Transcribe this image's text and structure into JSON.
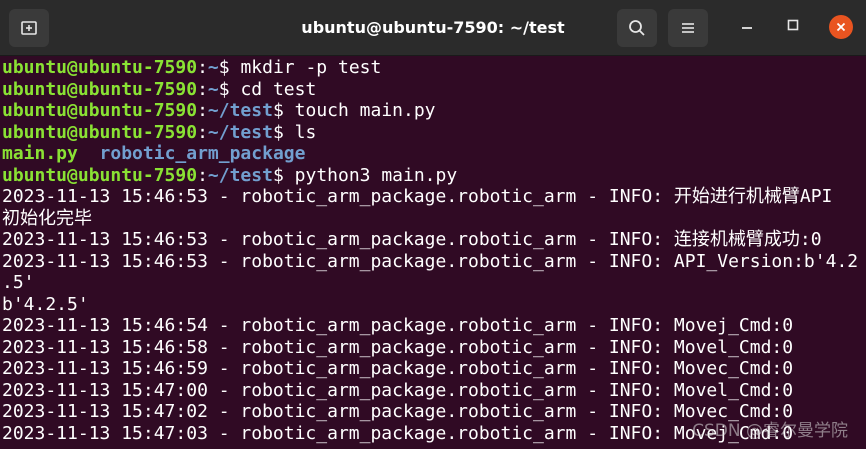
{
  "window": {
    "title": "ubuntu@ubuntu-7590: ~/test",
    "buttons": {
      "new_tab_icon": "new-tab-icon",
      "search_icon": "search-icon",
      "menu_icon": "hamburger-menu-icon",
      "minimize_icon": "minimize-icon",
      "maximize_icon": "maximize-icon",
      "close_icon": "close-icon"
    },
    "colors": {
      "background": "#300a24",
      "prompt_user": "#8ae234",
      "prompt_path": "#729fcf",
      "close_button": "#e95420"
    }
  },
  "terminal": {
    "prompts": [
      {
        "user": "ubuntu@ubuntu-7590",
        "sep": ":",
        "path": "~",
        "sym": "$ ",
        "cmd": "mkdir -p test"
      },
      {
        "user": "ubuntu@ubuntu-7590",
        "sep": ":",
        "path": "~",
        "sym": "$ ",
        "cmd": "cd test"
      },
      {
        "user": "ubuntu@ubuntu-7590",
        "sep": ":",
        "path": "~/test",
        "sym": "$ ",
        "cmd": "touch main.py"
      },
      {
        "user": "ubuntu@ubuntu-7590",
        "sep": ":",
        "path": "~/test",
        "sym": "$ ",
        "cmd": "ls"
      }
    ],
    "ls_output": {
      "file": "main.py",
      "gap": "  ",
      "dir": "robotic_arm_package"
    },
    "prompt5": {
      "user": "ubuntu@ubuntu-7590",
      "sep": ":",
      "path": "~/test",
      "sym": "$ ",
      "cmd": "python3 main.py"
    },
    "output": [
      "2023-11-13 15:46:53 - robotic_arm_package.robotic_arm - INFO: 开始进行机械臂API",
      "初始化完毕",
      "2023-11-13 15:46:53 - robotic_arm_package.robotic_arm - INFO: 连接机械臂成功:0",
      "2023-11-13 15:46:53 - robotic_arm_package.robotic_arm - INFO: API_Version:b'4.2",
      ".5'",
      "b'4.2.5'",
      "2023-11-13 15:46:54 - robotic_arm_package.robotic_arm - INFO: Movej_Cmd:0",
      "2023-11-13 15:46:58 - robotic_arm_package.robotic_arm - INFO: Movel_Cmd:0",
      "2023-11-13 15:46:59 - robotic_arm_package.robotic_arm - INFO: Movec_Cmd:0",
      "2023-11-13 15:47:00 - robotic_arm_package.robotic_arm - INFO: Movel_Cmd:0",
      "2023-11-13 15:47:02 - robotic_arm_package.robotic_arm - INFO: Movec_Cmd:0",
      "2023-11-13 15:47:03 - robotic_arm_package.robotic_arm - INFO: Movej_Cmd:0"
    ]
  },
  "watermark": "CSDN @睿尔曼学院"
}
